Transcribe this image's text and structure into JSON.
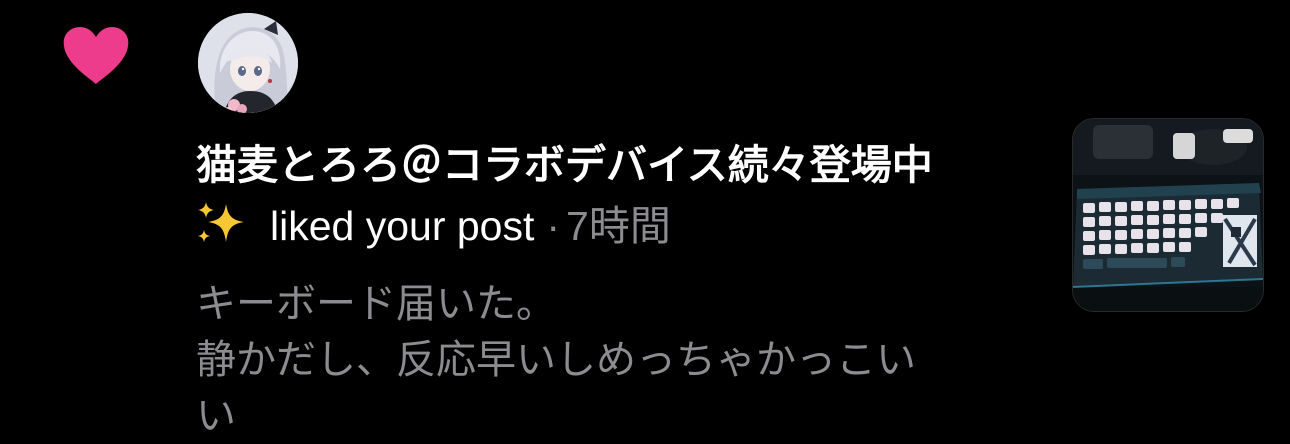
{
  "notification": {
    "type_icon": "heart-icon",
    "heart_color": "#ec3c8b",
    "avatar_icon": "avatar",
    "user_name": "猫麦とろろ＠コラボデバイス続々登場中",
    "action_emoji": "sparkles-icon",
    "action_text": "liked your post",
    "separator": "·",
    "time_ago": "7時間",
    "post_lines": [
      "キーボード届いた。",
      "静かだし、反応早いしめっちゃかっこい",
      "い"
    ],
    "thumbnail_icon": "keyboard-photo"
  },
  "colors": {
    "background": "#000000",
    "primary_text": "#ffffff",
    "secondary_text": "#8b8b90",
    "heart": "#ec3c8b"
  }
}
